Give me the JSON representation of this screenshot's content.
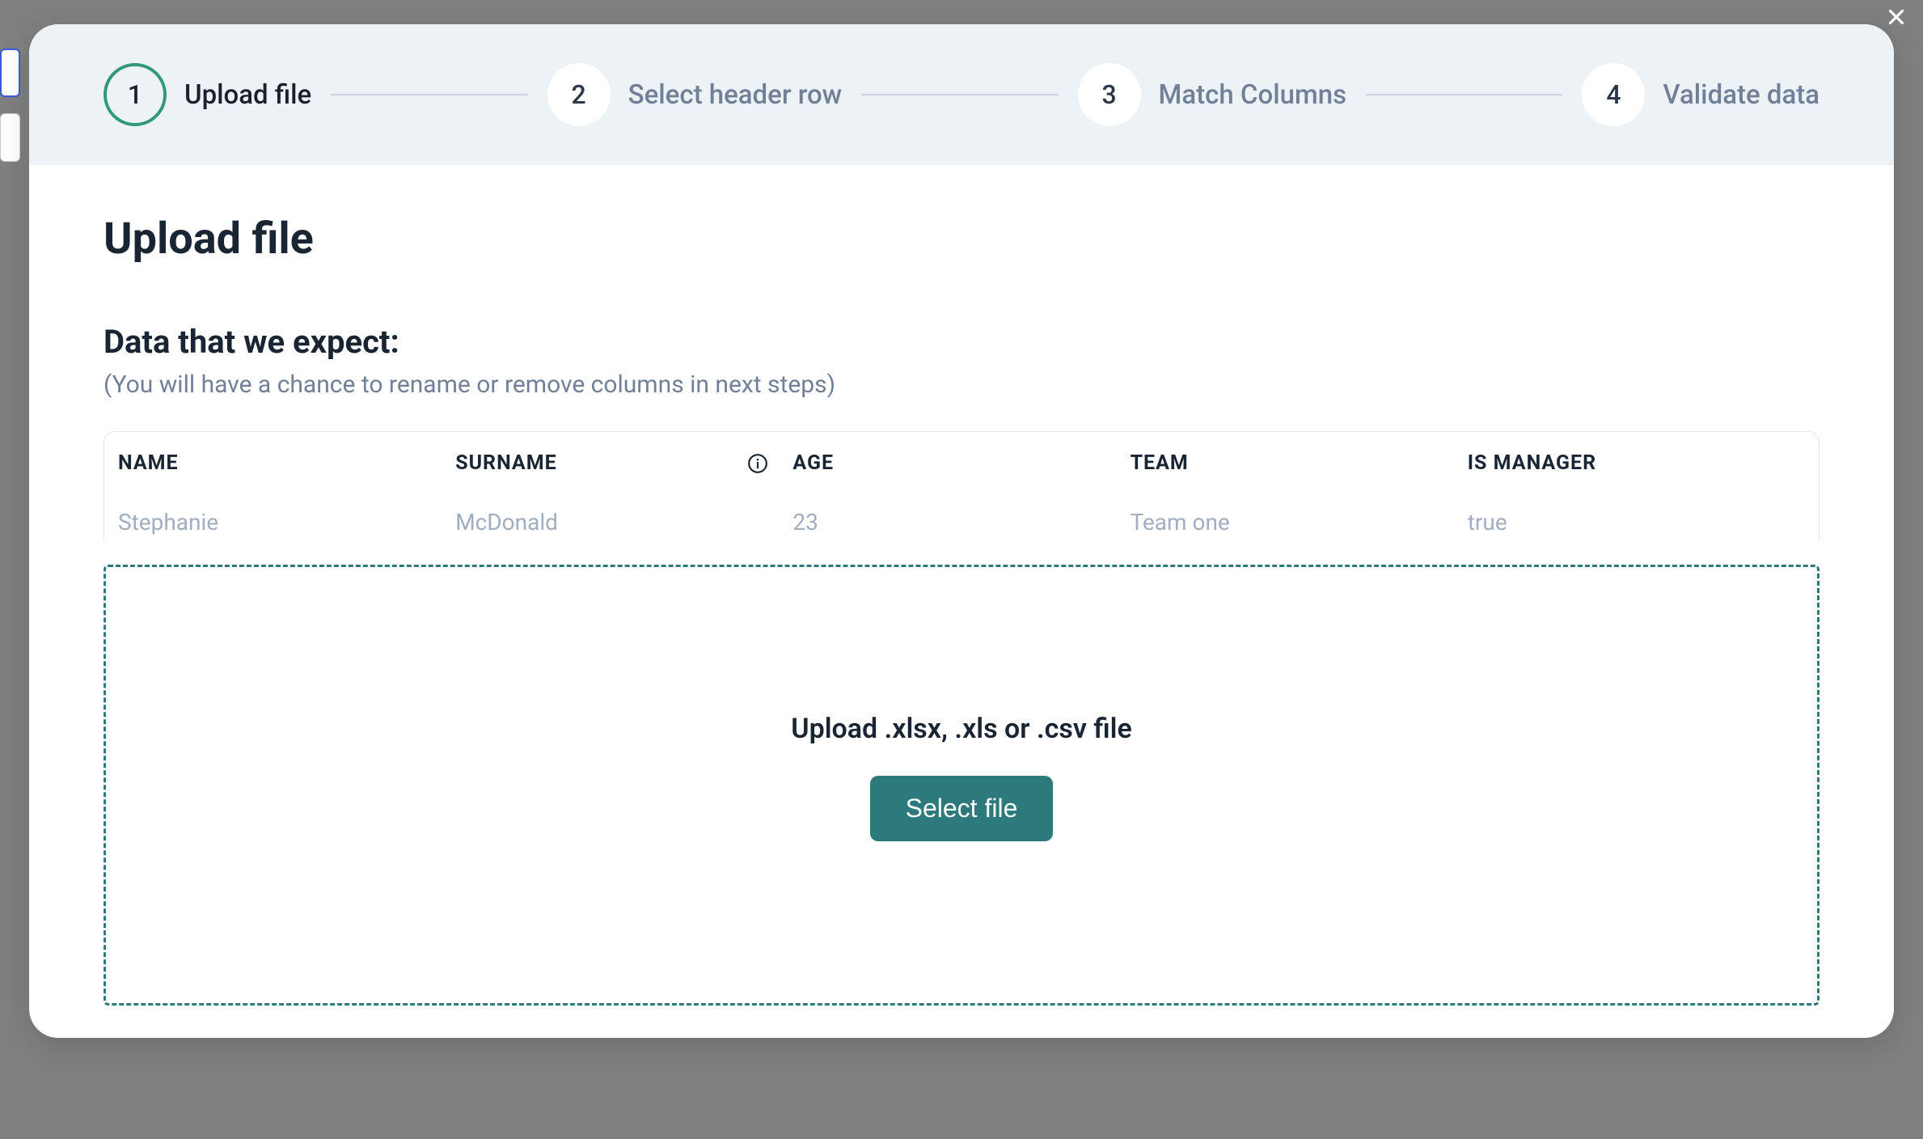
{
  "stepper": {
    "steps": [
      {
        "num": "1",
        "label": "Upload file",
        "active": true
      },
      {
        "num": "2",
        "label": "Select header row",
        "active": false
      },
      {
        "num": "3",
        "label": "Match Columns",
        "active": false
      },
      {
        "num": "4",
        "label": "Validate data",
        "active": false
      }
    ]
  },
  "content": {
    "title": "Upload file",
    "subtitle": "Data that we expect:",
    "subtitle_hint": "(You will have a chance to rename or remove columns in next steps)"
  },
  "table": {
    "headers": [
      "NAME",
      "SURNAME",
      "AGE",
      "TEAM",
      "IS MANAGER"
    ],
    "row": [
      "Stephanie",
      "McDonald",
      "23",
      "Team one",
      "true"
    ]
  },
  "dropzone": {
    "text": "Upload .xlsx, .xls or .csv file",
    "button": "Select file"
  }
}
